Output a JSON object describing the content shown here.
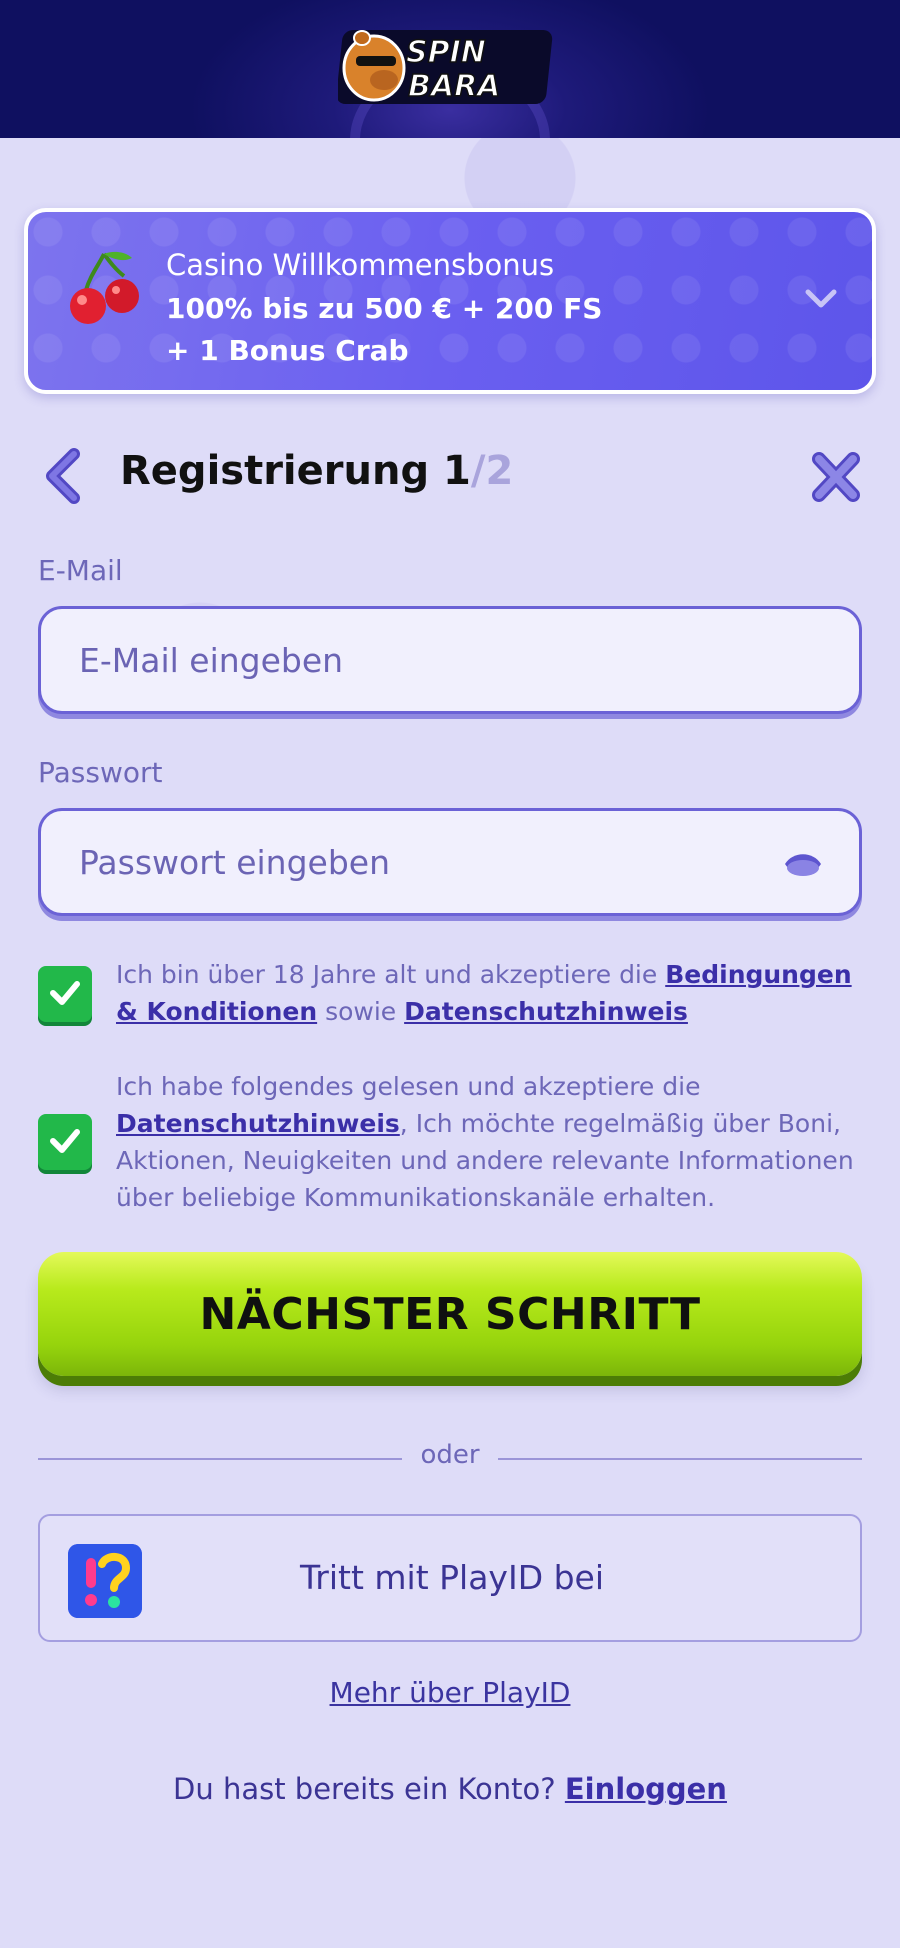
{
  "brand": {
    "logo_line1": "SPIN",
    "logo_line2": "BARA"
  },
  "bonus": {
    "line1": "Casino Willkommensbonus",
    "line2": "100% bis zu 500 € + 200 FS",
    "line3": "+ 1 Bonus Crab"
  },
  "registration": {
    "title": "Registrierung 1",
    "step_total": "/2"
  },
  "email": {
    "label": "E-Mail",
    "placeholder": "E-Mail eingeben"
  },
  "password": {
    "label": "Passwort",
    "placeholder": "Passwort eingeben"
  },
  "consent1": {
    "checked": true,
    "text_a": "Ich bin über 18 Jahre alt und akzeptiere die ",
    "link1": "Bedingungen & Konditionen",
    "text_b": " sowie ",
    "link2": "Datenschutzhinweis"
  },
  "consent2": {
    "checked": true,
    "text_a": "Ich habe folgendes gelesen und akzeptiere die ",
    "link1": "Datenschutzhinweis",
    "text_b": ", Ich möchte regelmäßig über Boni, Aktionen, Neuigkeiten und andere relevante Informationen über beliebige Kommunikationskanäle erhalten."
  },
  "next_button": "NÄCHSTER SCHRITT",
  "divider_text": "oder",
  "playid": {
    "button_label": "Tritt mit PlayID bei",
    "more_link": "Mehr über PlayID"
  },
  "footer": {
    "question": "Du hast bereits ein Konto? ",
    "login_link": "Einloggen"
  },
  "colors": {
    "accent": "#6b62d6",
    "button_green": "#a6de12",
    "checkbox_green": "#22b84a",
    "bonus_bg": "#6a5ff0"
  }
}
